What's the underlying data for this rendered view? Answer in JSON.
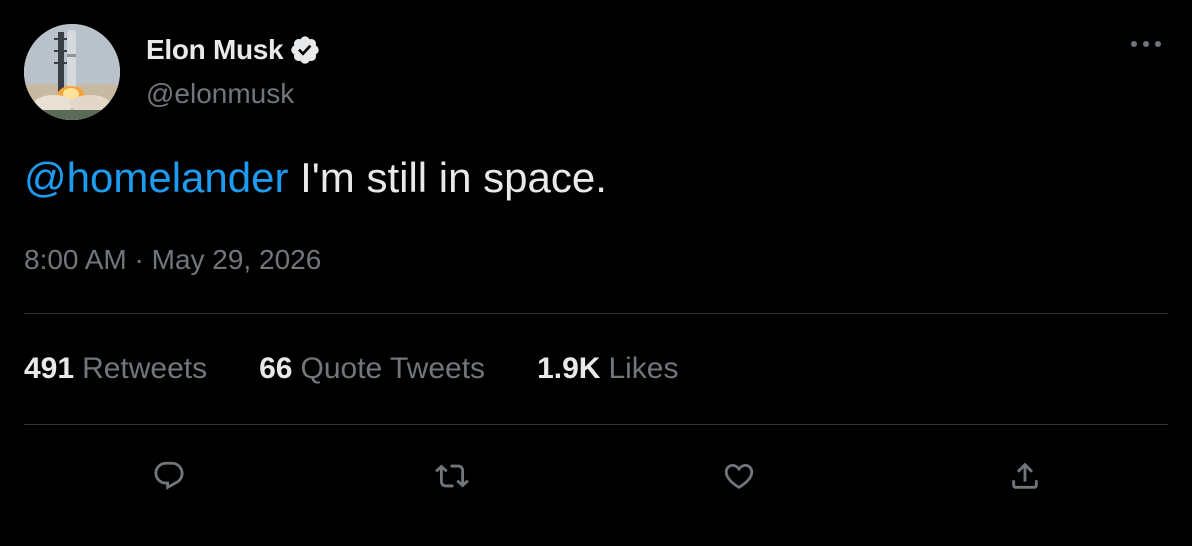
{
  "author": {
    "display_name": "Elon Musk",
    "handle": "@elonmusk",
    "verified": true,
    "avatar_icon": "rocket-launch-avatar"
  },
  "tweet": {
    "mention": "@homelander",
    "text": " I'm still in space.",
    "timestamp": "8:00 AM · May 29, 2026"
  },
  "stats": {
    "retweets_count": "491",
    "retweets_label": "Retweets",
    "quotes_count": "66",
    "quotes_label": "Quote Tweets",
    "likes_count": "1.9K",
    "likes_label": "Likes"
  },
  "actions": {
    "reply_icon": "reply-icon",
    "retweet_icon": "retweet-icon",
    "like_icon": "heart-icon",
    "share_icon": "share-icon"
  },
  "colors": {
    "background": "#000000",
    "text_primary": "#e7e9ea",
    "text_secondary": "#71767b",
    "accent": "#1d9bf0",
    "divider": "#2f3336"
  }
}
